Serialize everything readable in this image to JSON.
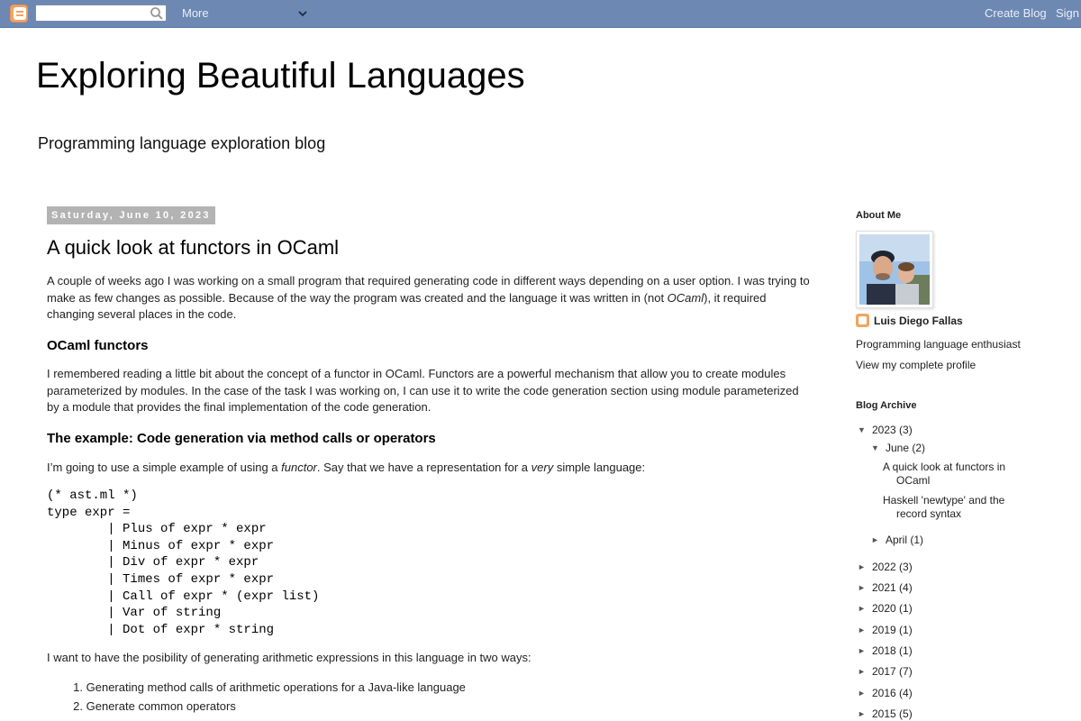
{
  "navbar": {
    "search_placeholder": "",
    "more_label": "More",
    "create_blog_label": "Create Blog",
    "sign_in_label": "Sign"
  },
  "header": {
    "title": "Exploring Beautiful Languages",
    "description": "Programming language exploration blog"
  },
  "post": {
    "date": "Saturday, June 10, 2023",
    "title": "A quick look at functors in OCaml",
    "p1_a": "A couple of weeks ago I was working on a small program that required generating code in different ways depending on a user option. I was trying to make as few changes as possible. Because of the way the program was created and the language it was written in (not ",
    "p1_em": "OCaml",
    "p1_b": "), it required changing several places in the code.",
    "h_functors": "OCaml functors",
    "p2": "I remembered reading a little bit about the concept of a functor in OCaml. Functors are a powerful mechanism that allow you to create modules parameterized by modules. In the case of the task I was working on, I can use it to write the code generation section using module parameterized by a module that provides the final implementation of the code generation.",
    "h_example": "The example: Code generation via method calls or operators",
    "p3_a": "I’m going to use a simple example of using a ",
    "p3_em1": "functor",
    "p3_b": ". Say that we have a representation for a ",
    "p3_em2": "very",
    "p3_c": " simple language:",
    "code": [
      "(* ast.ml *)",
      "type expr =",
      "        | Plus of expr * expr",
      "        | Minus of expr * expr",
      "        | Div of expr * expr",
      "        | Times of expr * expr",
      "        | Call of expr * (expr list)",
      "        | Var of string",
      "        | Dot of expr * string"
    ],
    "p4": "I want to have the posibility of generating arithmetic expressions in this language in two ways:",
    "list": [
      {
        "num": "1.",
        "text": "Generating method calls of arithmetic operations for a Java-like language"
      },
      {
        "num": "2.",
        "text": "Generate common operators"
      }
    ]
  },
  "sidebar": {
    "about_heading": "About Me",
    "profile_name": "Luis Diego Fallas",
    "profile_about": "Programming language enthusiast",
    "profile_link": "View my complete profile",
    "archive_heading": "Blog Archive",
    "year_2023": {
      "year": "2023",
      "count": "(3)",
      "toggle": "▼"
    },
    "june": {
      "month": "June",
      "count": "(2)",
      "toggle": "▼"
    },
    "june_posts": [
      {
        "l1": "A quick look at functors in",
        "l2": "OCaml"
      },
      {
        "l1": "Haskell 'newtype' and the",
        "l2": "record syntax"
      }
    ],
    "april": {
      "month": "April",
      "count": "(1)",
      "toggle": "►"
    },
    "years": [
      {
        "year": "2022",
        "count": "(3)",
        "toggle": "►"
      },
      {
        "year": "2021",
        "count": "(4)",
        "toggle": "►"
      },
      {
        "year": "2020",
        "count": "(1)",
        "toggle": "►"
      },
      {
        "year": "2019",
        "count": "(1)",
        "toggle": "►"
      },
      {
        "year": "2018",
        "count": "(1)",
        "toggle": "►"
      },
      {
        "year": "2017",
        "count": "(7)",
        "toggle": "►"
      },
      {
        "year": "2016",
        "count": "(4)",
        "toggle": "►"
      },
      {
        "year": "2015",
        "count": "(5)",
        "toggle": "►"
      }
    ]
  },
  "colors": {
    "navbar_bg": "#6d88b3",
    "date_header_bg": "#b3b3b3",
    "blogger_orange": "#f4a460"
  }
}
